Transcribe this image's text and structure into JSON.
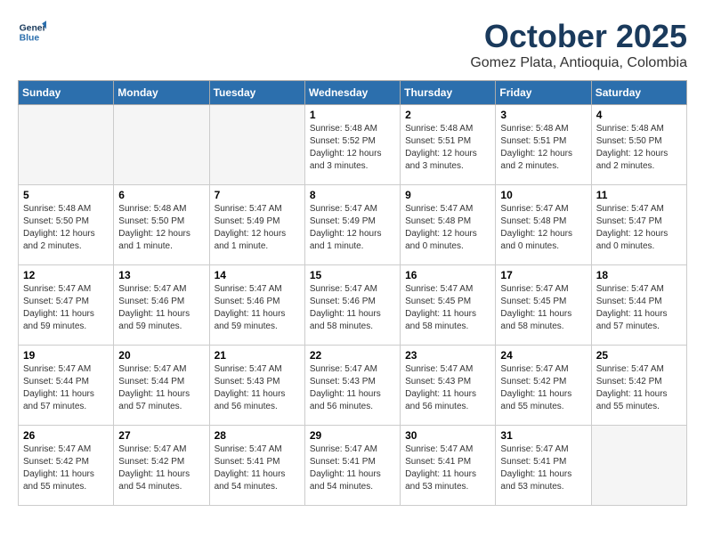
{
  "header": {
    "logo_line1": "General",
    "logo_line2": "Blue",
    "month": "October 2025",
    "location": "Gomez Plata, Antioquia, Colombia"
  },
  "weekdays": [
    "Sunday",
    "Monday",
    "Tuesday",
    "Wednesday",
    "Thursday",
    "Friday",
    "Saturday"
  ],
  "weeks": [
    [
      {
        "day": "",
        "info": ""
      },
      {
        "day": "",
        "info": ""
      },
      {
        "day": "",
        "info": ""
      },
      {
        "day": "1",
        "info": "Sunrise: 5:48 AM\nSunset: 5:52 PM\nDaylight: 12 hours\nand 3 minutes."
      },
      {
        "day": "2",
        "info": "Sunrise: 5:48 AM\nSunset: 5:51 PM\nDaylight: 12 hours\nand 3 minutes."
      },
      {
        "day": "3",
        "info": "Sunrise: 5:48 AM\nSunset: 5:51 PM\nDaylight: 12 hours\nand 2 minutes."
      },
      {
        "day": "4",
        "info": "Sunrise: 5:48 AM\nSunset: 5:50 PM\nDaylight: 12 hours\nand 2 minutes."
      }
    ],
    [
      {
        "day": "5",
        "info": "Sunrise: 5:48 AM\nSunset: 5:50 PM\nDaylight: 12 hours\nand 2 minutes."
      },
      {
        "day": "6",
        "info": "Sunrise: 5:48 AM\nSunset: 5:50 PM\nDaylight: 12 hours\nand 1 minute."
      },
      {
        "day": "7",
        "info": "Sunrise: 5:47 AM\nSunset: 5:49 PM\nDaylight: 12 hours\nand 1 minute."
      },
      {
        "day": "8",
        "info": "Sunrise: 5:47 AM\nSunset: 5:49 PM\nDaylight: 12 hours\nand 1 minute."
      },
      {
        "day": "9",
        "info": "Sunrise: 5:47 AM\nSunset: 5:48 PM\nDaylight: 12 hours\nand 0 minutes."
      },
      {
        "day": "10",
        "info": "Sunrise: 5:47 AM\nSunset: 5:48 PM\nDaylight: 12 hours\nand 0 minutes."
      },
      {
        "day": "11",
        "info": "Sunrise: 5:47 AM\nSunset: 5:47 PM\nDaylight: 12 hours\nand 0 minutes."
      }
    ],
    [
      {
        "day": "12",
        "info": "Sunrise: 5:47 AM\nSunset: 5:47 PM\nDaylight: 11 hours\nand 59 minutes."
      },
      {
        "day": "13",
        "info": "Sunrise: 5:47 AM\nSunset: 5:46 PM\nDaylight: 11 hours\nand 59 minutes."
      },
      {
        "day": "14",
        "info": "Sunrise: 5:47 AM\nSunset: 5:46 PM\nDaylight: 11 hours\nand 59 minutes."
      },
      {
        "day": "15",
        "info": "Sunrise: 5:47 AM\nSunset: 5:46 PM\nDaylight: 11 hours\nand 58 minutes."
      },
      {
        "day": "16",
        "info": "Sunrise: 5:47 AM\nSunset: 5:45 PM\nDaylight: 11 hours\nand 58 minutes."
      },
      {
        "day": "17",
        "info": "Sunrise: 5:47 AM\nSunset: 5:45 PM\nDaylight: 11 hours\nand 58 minutes."
      },
      {
        "day": "18",
        "info": "Sunrise: 5:47 AM\nSunset: 5:44 PM\nDaylight: 11 hours\nand 57 minutes."
      }
    ],
    [
      {
        "day": "19",
        "info": "Sunrise: 5:47 AM\nSunset: 5:44 PM\nDaylight: 11 hours\nand 57 minutes."
      },
      {
        "day": "20",
        "info": "Sunrise: 5:47 AM\nSunset: 5:44 PM\nDaylight: 11 hours\nand 57 minutes."
      },
      {
        "day": "21",
        "info": "Sunrise: 5:47 AM\nSunset: 5:43 PM\nDaylight: 11 hours\nand 56 minutes."
      },
      {
        "day": "22",
        "info": "Sunrise: 5:47 AM\nSunset: 5:43 PM\nDaylight: 11 hours\nand 56 minutes."
      },
      {
        "day": "23",
        "info": "Sunrise: 5:47 AM\nSunset: 5:43 PM\nDaylight: 11 hours\nand 56 minutes."
      },
      {
        "day": "24",
        "info": "Sunrise: 5:47 AM\nSunset: 5:42 PM\nDaylight: 11 hours\nand 55 minutes."
      },
      {
        "day": "25",
        "info": "Sunrise: 5:47 AM\nSunset: 5:42 PM\nDaylight: 11 hours\nand 55 minutes."
      }
    ],
    [
      {
        "day": "26",
        "info": "Sunrise: 5:47 AM\nSunset: 5:42 PM\nDaylight: 11 hours\nand 55 minutes."
      },
      {
        "day": "27",
        "info": "Sunrise: 5:47 AM\nSunset: 5:42 PM\nDaylight: 11 hours\nand 54 minutes."
      },
      {
        "day": "28",
        "info": "Sunrise: 5:47 AM\nSunset: 5:41 PM\nDaylight: 11 hours\nand 54 minutes."
      },
      {
        "day": "29",
        "info": "Sunrise: 5:47 AM\nSunset: 5:41 PM\nDaylight: 11 hours\nand 54 minutes."
      },
      {
        "day": "30",
        "info": "Sunrise: 5:47 AM\nSunset: 5:41 PM\nDaylight: 11 hours\nand 53 minutes."
      },
      {
        "day": "31",
        "info": "Sunrise: 5:47 AM\nSunset: 5:41 PM\nDaylight: 11 hours\nand 53 minutes."
      },
      {
        "day": "",
        "info": ""
      }
    ]
  ]
}
